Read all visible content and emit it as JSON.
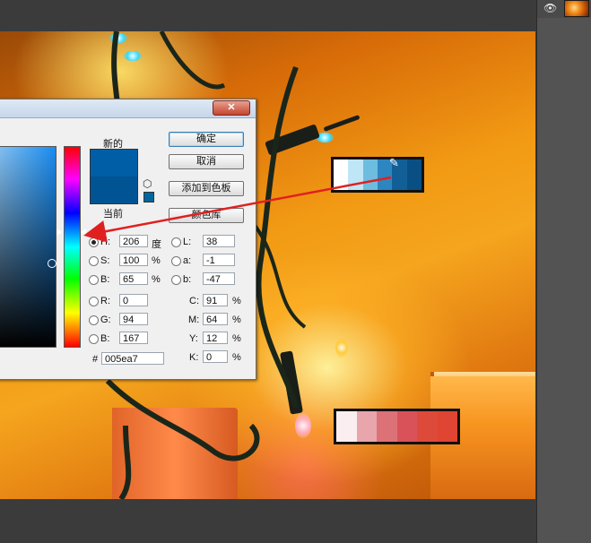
{
  "dialog": {
    "new_label": "新的",
    "current_label": "当前",
    "buttons": {
      "ok": "确定",
      "cancel": "取消",
      "add_swatch": "添加到色板",
      "libraries": "颜色库"
    },
    "new_color": "#005ea7",
    "current_color": "#005494",
    "fields": {
      "H": {
        "label": "H:",
        "value": "206",
        "unit": "度"
      },
      "S": {
        "label": "S:",
        "value": "100",
        "unit": "%"
      },
      "B": {
        "label": "B:",
        "value": "65",
        "unit": "%"
      },
      "R": {
        "label": "R:",
        "value": "0"
      },
      "G": {
        "label": "G:",
        "value": "94"
      },
      "Bb": {
        "label": "B:",
        "value": "167"
      },
      "L": {
        "label": "L:",
        "value": "38"
      },
      "a": {
        "label": "a:",
        "value": "-1"
      },
      "b": {
        "label": "b:",
        "value": "-47"
      },
      "C": {
        "label": "C:",
        "value": "91",
        "unit": "%"
      },
      "M": {
        "label": "M:",
        "value": "64",
        "unit": "%"
      },
      "Y": {
        "label": "Y:",
        "value": "12",
        "unit": "%"
      },
      "K": {
        "label": "K:",
        "value": "0",
        "unit": "%"
      }
    },
    "hex": {
      "label": "#",
      "value": "005ea7"
    },
    "close_glyph": "✕"
  },
  "swatches_top": [
    "#ffffff",
    "#bfe6f7",
    "#6dbde0",
    "#2e86c0",
    "#125f98",
    "#0a4f84"
  ],
  "swatches_bottom": [
    "#fbeef0",
    "#e8a5ac",
    "#dd7178",
    "#d9525a",
    "#de4a3a",
    "#e04432"
  ],
  "layers": {
    "visibility_icon": "eye-icon"
  },
  "annotation_color": "#e02020"
}
